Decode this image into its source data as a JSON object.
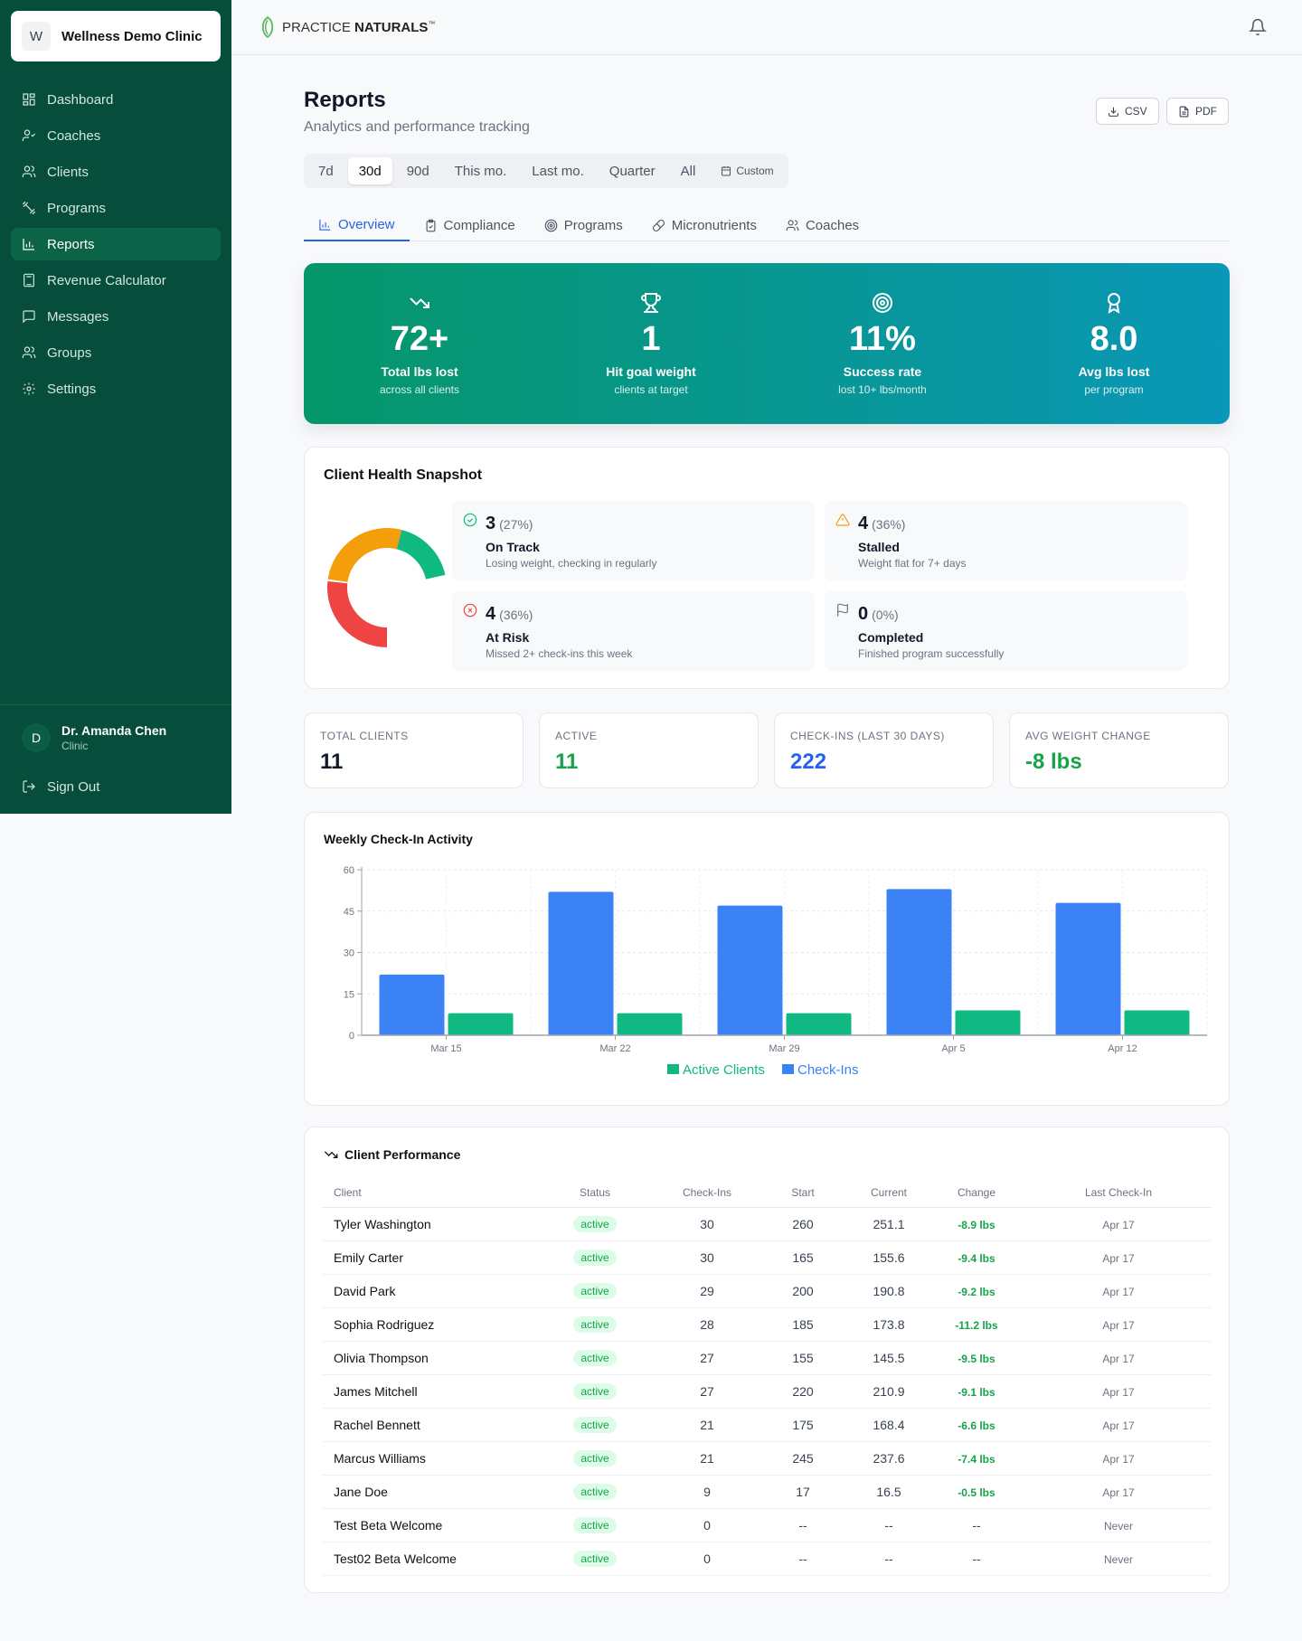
{
  "sidebar": {
    "clinic_initial": "W",
    "clinic_name": "Wellness Demo Clinic",
    "items": [
      {
        "label": "Dashboard",
        "icon": "grid-icon"
      },
      {
        "label": "Coaches",
        "icon": "user-check-icon"
      },
      {
        "label": "Clients",
        "icon": "users-icon"
      },
      {
        "label": "Programs",
        "icon": "dumbbell-icon"
      },
      {
        "label": "Reports",
        "icon": "bar-chart-icon"
      },
      {
        "label": "Revenue Calculator",
        "icon": "calculator-icon"
      },
      {
        "label": "Messages",
        "icon": "message-icon"
      },
      {
        "label": "Groups",
        "icon": "users-icon"
      },
      {
        "label": "Settings",
        "icon": "gear-icon"
      }
    ],
    "active": "Reports",
    "user": {
      "initial": "D",
      "name": "Dr. Amanda Chen",
      "role": "Clinic"
    },
    "sign_out": "Sign Out"
  },
  "header": {
    "brand_light": "PRACTICE ",
    "brand_bold": "NATURALS",
    "tm": "™"
  },
  "page": {
    "title": "Reports",
    "subtitle": "Analytics and performance tracking",
    "csv": "CSV",
    "pdf": "PDF"
  },
  "filters": {
    "options": [
      "7d",
      "30d",
      "90d",
      "This mo.",
      "Last mo.",
      "Quarter",
      "All"
    ],
    "custom": "Custom",
    "selected": "30d"
  },
  "tabs": [
    "Overview",
    "Compliance",
    "Programs",
    "Micronutrients",
    "Coaches"
  ],
  "banner": [
    {
      "value": "72+",
      "label": "Total lbs lost",
      "sub": "across all clients"
    },
    {
      "value": "1",
      "label": "Hit goal weight",
      "sub": "clients at target"
    },
    {
      "value": "11%",
      "label": "Success rate",
      "sub": "lost 10+ lbs/month"
    },
    {
      "value": "8.0",
      "label": "Avg lbs lost",
      "sub": "per program"
    }
  ],
  "health": {
    "title": "Client Health Snapshot",
    "items": [
      {
        "count": "3",
        "pct": "(27%)",
        "label": "On Track",
        "desc": "Losing weight, checking in regularly",
        "color": "#10b981"
      },
      {
        "count": "4",
        "pct": "(36%)",
        "label": "Stalled",
        "desc": "Weight flat for 7+ days",
        "color": "#f59e0b"
      },
      {
        "count": "4",
        "pct": "(36%)",
        "label": "At Risk",
        "desc": "Missed 2+ check-ins this week",
        "color": "#ef4444"
      },
      {
        "count": "0",
        "pct": "(0%)",
        "label": "Completed",
        "desc": "Finished program successfully",
        "color": "#6b7280"
      }
    ]
  },
  "stats": [
    {
      "label": "TOTAL CLIENTS",
      "value": "11",
      "color": "#111827"
    },
    {
      "label": "ACTIVE",
      "value": "11",
      "color": "#16a34a"
    },
    {
      "label": "CHECK-INS (LAST 30 DAYS)",
      "value": "222",
      "color": "#2563eb"
    },
    {
      "label": "AVG WEIGHT CHANGE",
      "value": "-8 lbs",
      "color": "#16a34a"
    }
  ],
  "chart_data": {
    "type": "bar",
    "title": "Weekly Check-In Activity",
    "categories": [
      "Mar 15",
      "Mar 22",
      "Mar 29",
      "Apr 5",
      "Apr 12"
    ],
    "series": [
      {
        "name": "Check-Ins",
        "values": [
          22,
          52,
          47,
          53,
          48
        ],
        "color": "#3b82f6"
      },
      {
        "name": "Active Clients",
        "values": [
          8,
          8,
          8,
          9,
          9
        ],
        "color": "#10b981"
      }
    ],
    "legend": [
      "Active Clients",
      "Check-Ins"
    ],
    "yticks": [
      "0",
      "15",
      "30",
      "45",
      "60"
    ],
    "ylim": [
      0,
      60
    ],
    "grid": true,
    "legend_position": "bottom"
  },
  "performance": {
    "title": "Client Performance",
    "columns": [
      "Client",
      "Status",
      "Check-Ins",
      "Start",
      "Current",
      "Change",
      "Last Check-In"
    ],
    "rows": [
      [
        "Tyler Washington",
        "active",
        "30",
        "260",
        "251.1",
        "-8.9 lbs",
        "Apr 17"
      ],
      [
        "Emily Carter",
        "active",
        "30",
        "165",
        "155.6",
        "-9.4 lbs",
        "Apr 17"
      ],
      [
        "David Park",
        "active",
        "29",
        "200",
        "190.8",
        "-9.2 lbs",
        "Apr 17"
      ],
      [
        "Sophia Rodriguez",
        "active",
        "28",
        "185",
        "173.8",
        "-11.2 lbs",
        "Apr 17"
      ],
      [
        "Olivia Thompson",
        "active",
        "27",
        "155",
        "145.5",
        "-9.5 lbs",
        "Apr 17"
      ],
      [
        "James Mitchell",
        "active",
        "27",
        "220",
        "210.9",
        "-9.1 lbs",
        "Apr 17"
      ],
      [
        "Rachel Bennett",
        "active",
        "21",
        "175",
        "168.4",
        "-6.6 lbs",
        "Apr 17"
      ],
      [
        "Marcus Williams",
        "active",
        "21",
        "245",
        "237.6",
        "-7.4 lbs",
        "Apr 17"
      ],
      [
        "Jane Doe",
        "active",
        "9",
        "17",
        "16.5",
        "-0.5 lbs",
        "Apr 17"
      ],
      [
        "Test Beta Welcome",
        "active",
        "0",
        "--",
        "--",
        "--",
        "Never"
      ],
      [
        "Test02 Beta Welcome",
        "active",
        "0",
        "--",
        "--",
        "--",
        "Never"
      ]
    ]
  }
}
